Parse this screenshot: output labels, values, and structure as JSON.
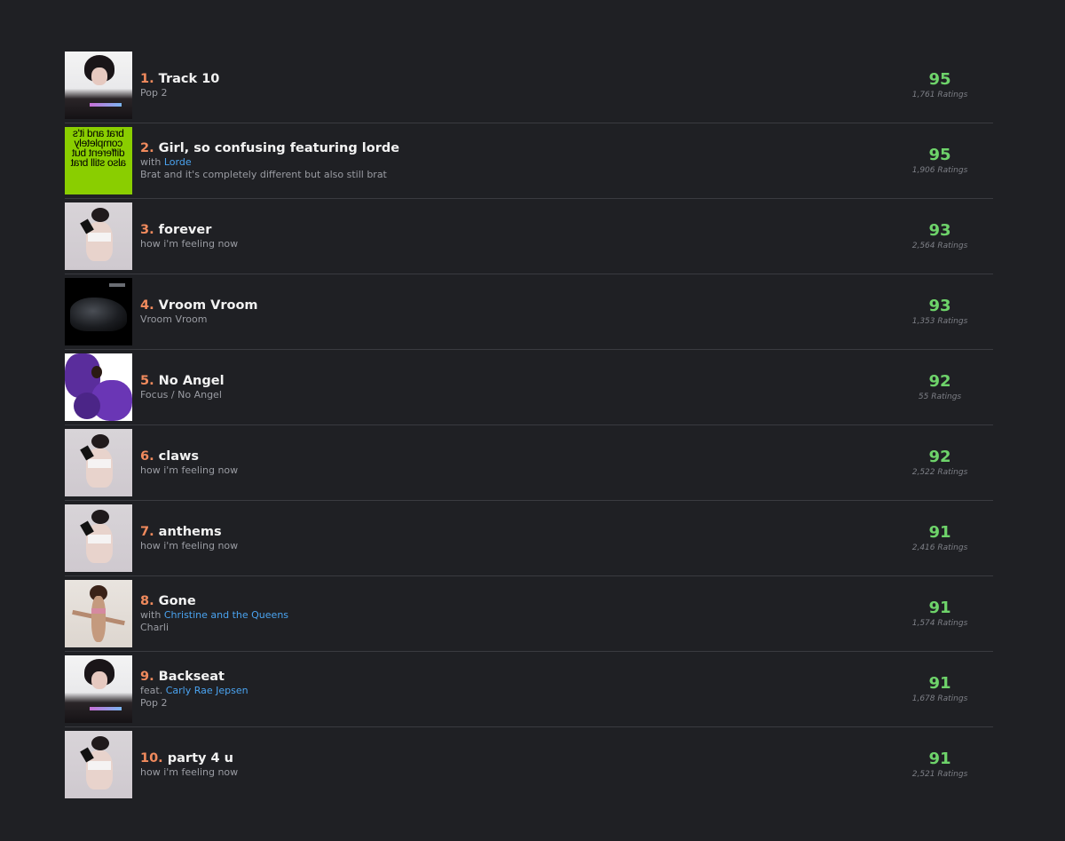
{
  "tracks": [
    {
      "rank": "1.",
      "title": "Track 10",
      "collab_prefix": "",
      "collab_artist": "",
      "album": "Pop 2",
      "score": "95",
      "ratings": "1,761 Ratings",
      "cover": "pop2"
    },
    {
      "rank": "2.",
      "title": "Girl, so confusing featuring lorde",
      "collab_prefix": "with",
      "collab_artist": "Lorde",
      "album": "Brat and it's completely different but also still brat",
      "score": "95",
      "ratings": "1,906 Ratings",
      "cover": "brat",
      "cover_text": "brat and it's completely different but also still brat"
    },
    {
      "rank": "3.",
      "title": "forever",
      "collab_prefix": "",
      "collab_artist": "",
      "album": "how i'm feeling now",
      "score": "93",
      "ratings": "2,564 Ratings",
      "cover": "feeling"
    },
    {
      "rank": "4.",
      "title": "Vroom Vroom",
      "collab_prefix": "",
      "collab_artist": "",
      "album": "Vroom Vroom",
      "score": "93",
      "ratings": "1,353 Ratings",
      "cover": "vroom"
    },
    {
      "rank": "5.",
      "title": "No Angel",
      "collab_prefix": "",
      "collab_artist": "",
      "album": "Focus / No Angel",
      "score": "92",
      "ratings": "55 Ratings",
      "cover": "angel"
    },
    {
      "rank": "6.",
      "title": "claws",
      "collab_prefix": "",
      "collab_artist": "",
      "album": "how i'm feeling now",
      "score": "92",
      "ratings": "2,522 Ratings",
      "cover": "feeling"
    },
    {
      "rank": "7.",
      "title": "anthems",
      "collab_prefix": "",
      "collab_artist": "",
      "album": "how i'm feeling now",
      "score": "91",
      "ratings": "2,416 Ratings",
      "cover": "feeling"
    },
    {
      "rank": "8.",
      "title": "Gone",
      "collab_prefix": "with",
      "collab_artist": "Christine and the Queens",
      "album": "Charli",
      "score": "91",
      "ratings": "1,574 Ratings",
      "cover": "charli"
    },
    {
      "rank": "9.",
      "title": "Backseat",
      "collab_prefix": "feat.",
      "collab_artist": "Carly Rae Jepsen",
      "album": "Pop 2",
      "score": "91",
      "ratings": "1,678 Ratings",
      "cover": "pop2"
    },
    {
      "rank": "10.",
      "title": "party 4 u",
      "collab_prefix": "",
      "collab_artist": "",
      "album": "how i'm feeling now",
      "score": "91",
      "ratings": "2,521 Ratings",
      "cover": "feeling"
    }
  ],
  "colors": {
    "background": "#1f2024",
    "rank": "#f08a5d",
    "title": "#f2f2f2",
    "score": "#6ed36a",
    "link": "#4aa3f0",
    "subtext": "#9a9ca3"
  }
}
